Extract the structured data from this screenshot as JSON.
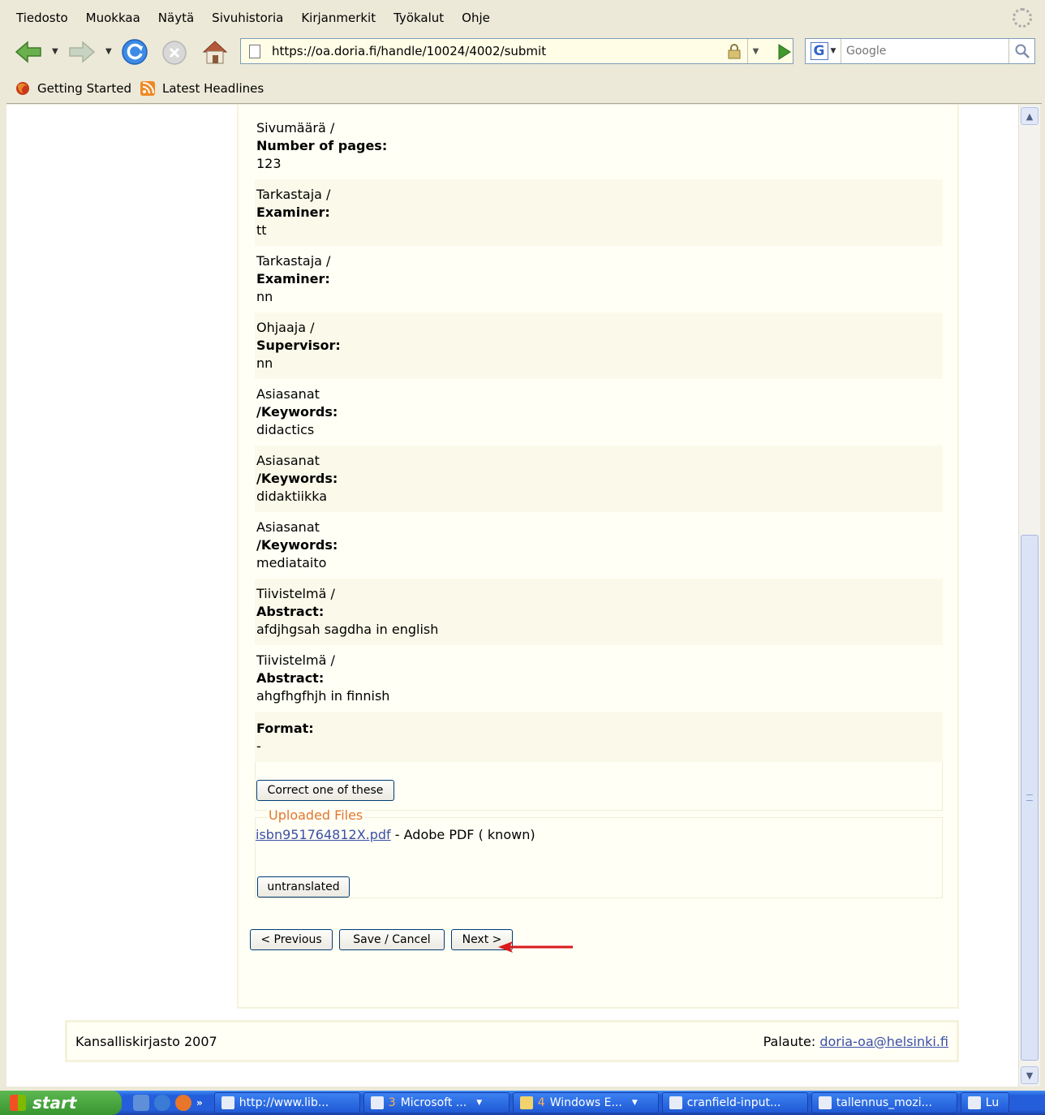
{
  "menu": [
    "Tiedosto",
    "Muokkaa",
    "Näytä",
    "Sivuhistoria",
    "Kirjanmerkit",
    "Työkalut",
    "Ohje"
  ],
  "address": {
    "url": "https://oa.doria.fi/handle/10024/4002/submit"
  },
  "search": {
    "placeholder": "Google"
  },
  "bookmarks": [
    "Getting Started",
    "Latest Headlines"
  ],
  "fields": [
    {
      "fi": "Sivumäärä /",
      "en": "Number of pages:",
      "value": "123"
    },
    {
      "fi": "Tarkastaja /",
      "en": "Examiner:",
      "value": "tt"
    },
    {
      "fi": "Tarkastaja /",
      "en": "Examiner:",
      "value": "nn"
    },
    {
      "fi": "Ohjaaja /",
      "en": "Supervisor:",
      "value": "nn"
    },
    {
      "fi": "Asiasanat",
      "en": "/Keywords:",
      "value": "didactics"
    },
    {
      "fi": "Asiasanat",
      "en": "/Keywords:",
      "value": "didaktiikka"
    },
    {
      "fi": "Asiasanat",
      "en": "/Keywords:",
      "value": "mediataito"
    },
    {
      "fi": "Tiivistelmä /",
      "en": "Abstract:",
      "value": "afdjhgsah sagdha in english"
    },
    {
      "fi": "Tiivistelmä /",
      "en": "Abstract:",
      "value": "ahgfhgfhjh in finnish"
    },
    {
      "fi": "",
      "en": "Format:",
      "value": "-"
    }
  ],
  "buttons": {
    "correct": "Correct one of these",
    "untranslated": "untranslated",
    "previous": "< Previous",
    "save_cancel": "Save / Cancel",
    "next": "Next >"
  },
  "uploaded": {
    "legend": "Uploaded Files",
    "file_name": "isbn951764812X.pdf",
    "file_desc": " - Adobe PDF ( known)"
  },
  "footer": {
    "left": "Kansalliskirjasto 2007",
    "feedback_label": "Palaute: ",
    "email": "doria-oa@helsinki.fi"
  },
  "taskbar": {
    "start": "start",
    "tasks": [
      {
        "label": "http://www.lib...",
        "count": "",
        "dropdown": false
      },
      {
        "label": " Microsoft ...",
        "count": "3",
        "dropdown": true
      },
      {
        "label": " Windows E...",
        "count": "4",
        "dropdown": true
      },
      {
        "label": "cranfield-input...",
        "count": "",
        "dropdown": false
      },
      {
        "label": "tallennus_mozi...",
        "count": "",
        "dropdown": false
      },
      {
        "label": "Lu",
        "count": "",
        "dropdown": false
      }
    ]
  },
  "colors": {
    "panel": "#fffff5",
    "legend": "#e2772f",
    "link": "#3b4fa5",
    "arrow": "#d91a1a"
  }
}
